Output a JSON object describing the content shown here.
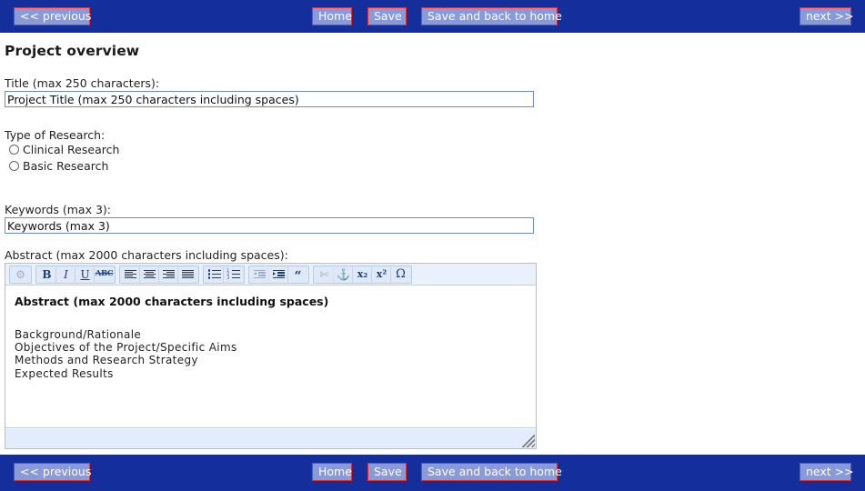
{
  "theme": {
    "nav_bg": "#142e9c",
    "nav_button_bg": "#8a9ad9",
    "nav_button_border": "#e03030",
    "nav_button_text": "#ffffff",
    "editor_toolbar_bg": "#eaf1fb",
    "input_border": "#6d8cc4"
  },
  "nav": {
    "previous_label": "<< previous",
    "home_label": "Home",
    "save_label": "Save",
    "save_back_home_label": "Save and back to home",
    "next_label": "next >>"
  },
  "page": {
    "title": "Project overview"
  },
  "form": {
    "title_field": {
      "label": "Title (max 250 characters):",
      "value": "Project Title (max 250 characters including spaces)",
      "placeholder": "Project Title (max 250 characters including spaces)"
    },
    "research_type": {
      "label": "Type of Research:",
      "options": [
        {
          "label": "Clinical Research",
          "selected": false
        },
        {
          "label": "Basic Research",
          "selected": false
        }
      ]
    },
    "keywords_field": {
      "label": "Keywords (max 3):",
      "value": "Keywords (max 3)",
      "placeholder": "Keywords (max 3)"
    },
    "abstract_field": {
      "label": "Abstract (max 2000 characters including spaces):",
      "heading": "Abstract (max 2000 characters including spaces)",
      "lines": [
        "Background/Rationale",
        "Objectives of the Project/Specific Aims",
        "Methods and Research Strategy",
        "Expected Results"
      ]
    }
  },
  "editor_toolbar": {
    "groups": [
      {
        "buttons": [
          {
            "name": "link-icon",
            "glyph": "⚇",
            "disabled": true
          }
        ]
      },
      {
        "buttons": [
          {
            "name": "bold-icon",
            "glyph": "B",
            "disabled": false
          },
          {
            "name": "italic-icon",
            "glyph": "I",
            "disabled": false
          },
          {
            "name": "underline-icon",
            "glyph": "U",
            "disabled": false
          },
          {
            "name": "strikethrough-icon",
            "glyph": "ABC",
            "disabled": false
          }
        ]
      },
      {
        "buttons": [
          {
            "name": "align-left-icon",
            "glyph": "",
            "disabled": false
          },
          {
            "name": "align-center-icon",
            "glyph": "",
            "disabled": false
          },
          {
            "name": "align-right-icon",
            "glyph": "",
            "disabled": false
          },
          {
            "name": "align-justify-icon",
            "glyph": "",
            "disabled": false
          }
        ]
      },
      {
        "buttons": [
          {
            "name": "bulleted-list-icon",
            "glyph": "",
            "disabled": false
          },
          {
            "name": "numbered-list-icon",
            "glyph": "",
            "disabled": false
          }
        ]
      },
      {
        "buttons": [
          {
            "name": "outdent-icon",
            "glyph": "",
            "disabled": true
          },
          {
            "name": "indent-icon",
            "glyph": "",
            "disabled": false
          },
          {
            "name": "blockquote-icon",
            "glyph": "“",
            "disabled": false
          }
        ]
      },
      {
        "buttons": [
          {
            "name": "unlink-icon",
            "glyph": "✂",
            "disabled": true
          },
          {
            "name": "anchor-icon",
            "glyph": "⚓",
            "disabled": false
          },
          {
            "name": "subscript-icon",
            "glyph": "x₂",
            "disabled": false
          },
          {
            "name": "superscript-icon",
            "glyph": "x²",
            "disabled": false
          },
          {
            "name": "special-character-icon",
            "glyph": "Ω",
            "disabled": false
          }
        ]
      }
    ]
  }
}
